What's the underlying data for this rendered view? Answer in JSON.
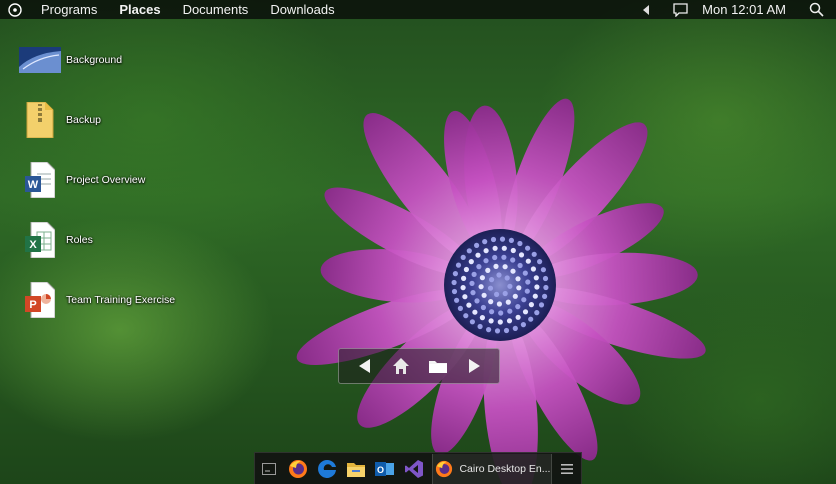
{
  "topbar": {
    "menu": [
      "Programs",
      "Places",
      "Documents",
      "Downloads"
    ],
    "active_menu": "Places",
    "clock": "Mon 12:01 AM",
    "icons": [
      "cairo-logo-icon",
      "chevron-left-icon",
      "action-center-icon",
      "search-icon"
    ]
  },
  "desktop": {
    "icons": [
      {
        "label": "Background",
        "icon": "image-thumbnail-icon"
      },
      {
        "label": "Backup",
        "icon": "zip-folder-icon"
      },
      {
        "label": "Project Overview",
        "icon": "word-document-icon"
      },
      {
        "label": "Roles",
        "icon": "excel-spreadsheet-icon"
      },
      {
        "label": "Team Training Exercise",
        "icon": "powerpoint-icon"
      }
    ]
  },
  "nav": {
    "buttons": [
      "back-arrow-icon",
      "home-icon",
      "folder-icon",
      "forward-arrow-icon"
    ]
  },
  "taskbar": {
    "pinned": [
      "show-desktop-icon",
      "firefox-icon",
      "edge-icon",
      "file-explorer-icon",
      "outlook-icon",
      "visual-studio-icon"
    ],
    "task_label": "Cairo Desktop En...",
    "task_icon": "firefox-icon",
    "menu_icon": "hamburger-menu-icon"
  },
  "colors": {
    "topbar_bg": "#0e130e",
    "petal": "#c34fc0",
    "flower_center": "#3a3f8f",
    "word_blue": "#2b5797",
    "excel_green": "#217346",
    "ppt_red": "#d24726"
  }
}
